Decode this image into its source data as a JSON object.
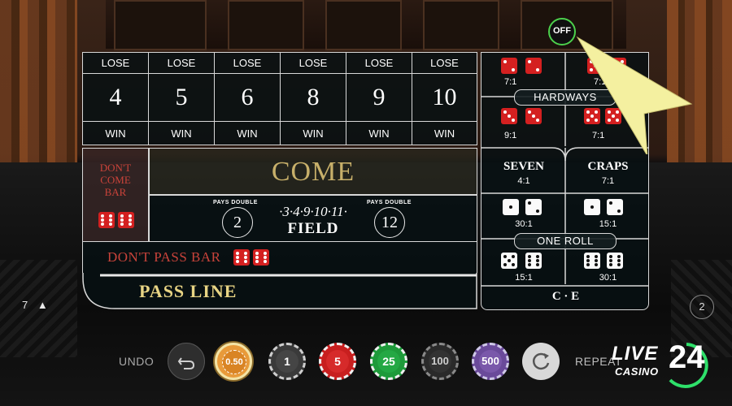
{
  "game": {
    "off_button": "OFF",
    "numbers": [
      {
        "lose": "LOSE",
        "value": "4",
        "win": "WIN"
      },
      {
        "lose": "LOSE",
        "value": "5",
        "win": "WIN"
      },
      {
        "lose": "LOSE",
        "value": "6",
        "win": "WIN"
      },
      {
        "lose": "LOSE",
        "value": "8",
        "win": "WIN"
      },
      {
        "lose": "LOSE",
        "value": "9",
        "win": "WIN"
      },
      {
        "lose": "LOSE",
        "value": "10",
        "win": "WIN"
      }
    ],
    "come": "COME",
    "dont_come_bar": "DON'T COME BAR",
    "field": {
      "label": "FIELD",
      "numbers": "·3·4·9·10·11·",
      "pays_double_left": "PAYS DOUBLE",
      "pays_double_right": "PAYS DOUBLE",
      "left_value": "2",
      "right_value": "12"
    },
    "dont_pass_bar": "DON'T PASS BAR",
    "pass_line": "PASS LINE",
    "props": {
      "hardways_label": "HARDWAYS",
      "hard_4_odds": "7:1",
      "hard_10_odds": "7:1",
      "hard_6_odds": "9:1",
      "hard_8_odds": "7:1",
      "seven_label": "SEVEN",
      "seven_odds": "4:1",
      "craps_label": "CRAPS",
      "craps_odds": "7:1",
      "one_roll_label": "ONE ROLL",
      "ace_deuce_odds": "30:1",
      "aces_odds": "15:1",
      "yo_left_odds": "15:1",
      "yo_right_odds": "30:1",
      "ce_label": "C · E"
    }
  },
  "controls": {
    "undo": "UNDO",
    "repeat": "REPEAT",
    "chips": [
      {
        "label": "0.50",
        "color": "#e89a3a",
        "selected": true
      },
      {
        "label": "1",
        "color": "#3a3a3a",
        "selected": false
      },
      {
        "label": "5",
        "color": "#c81f1f",
        "selected": false
      },
      {
        "label": "25",
        "color": "#1e9a3a",
        "selected": false
      },
      {
        "label": "100",
        "color": "#2a2a2a",
        "selected": false
      },
      {
        "label": "500",
        "color": "#6a4a9a",
        "selected": false
      }
    ],
    "limits_left": "7",
    "right_badge": "2"
  },
  "branding": {
    "live": "LIVE",
    "casino": "CASINO",
    "number": "24"
  }
}
